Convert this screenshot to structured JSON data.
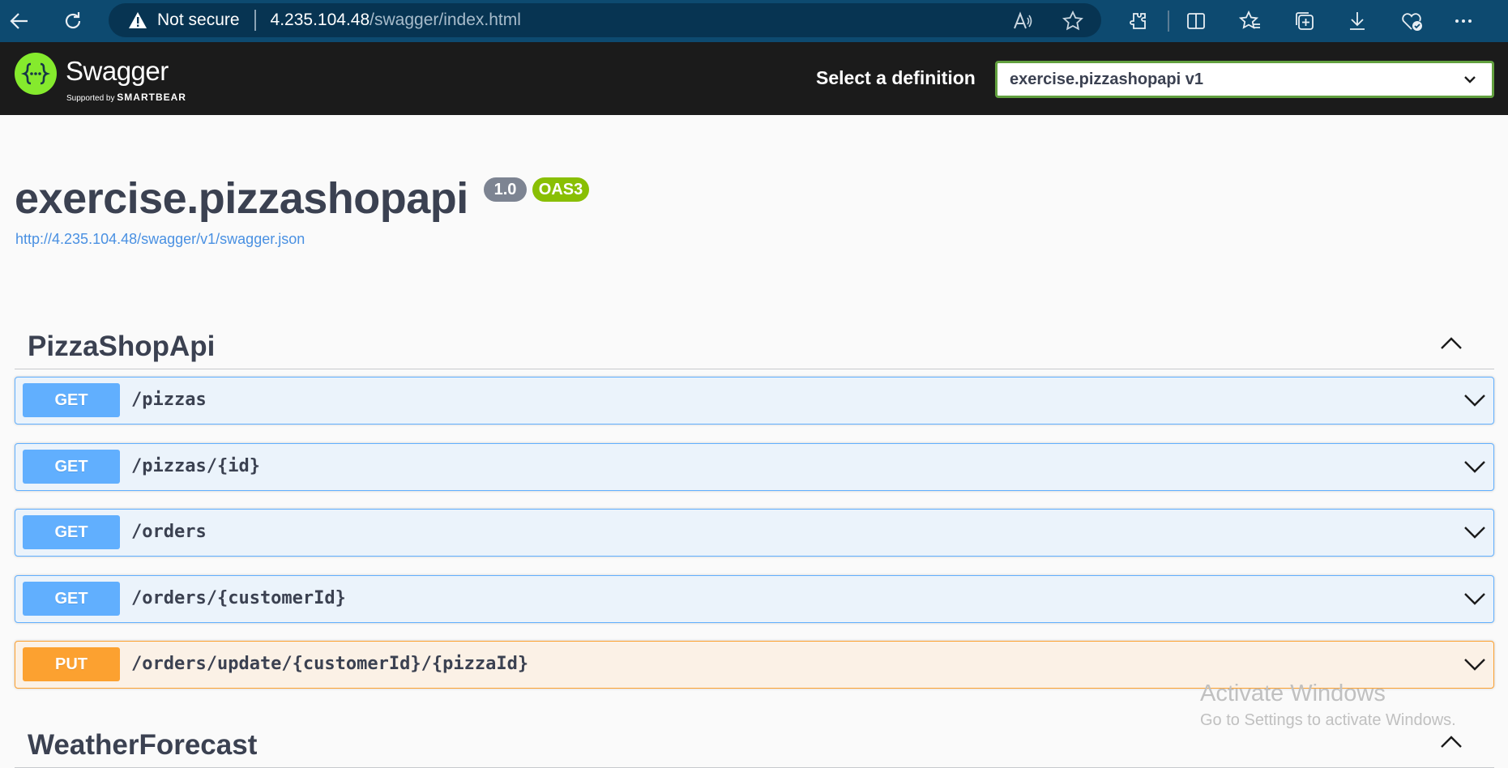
{
  "browser": {
    "not_secure": "Not secure",
    "url_host": "4.235.104.48",
    "url_path": "/swagger/index.html",
    "toolbar_icons": [
      "back-icon",
      "refresh-icon",
      "read-aloud-icon",
      "favorite-star-icon",
      "extensions-icon",
      "split-screen-icon",
      "favorites-icon",
      "collections-icon",
      "downloads-icon",
      "browser-essentials-icon",
      "more-icon"
    ]
  },
  "topbar": {
    "logo_text": "Swagger",
    "logo_sub_prefix": "Supported by",
    "logo_sub_brand": "SMARTBEAR",
    "definition_label": "Select a definition",
    "definition_selected": "exercise.pizzashopapi v1"
  },
  "info": {
    "title": "exercise.pizzashopapi",
    "version": "1.0",
    "oas": "OAS3",
    "spec_url": "http://4.235.104.48/swagger/v1/swagger.json"
  },
  "tags": [
    {
      "name": "PizzaShopApi",
      "operations": [
        {
          "method": "GET",
          "path": "/pizzas"
        },
        {
          "method": "GET",
          "path": "/pizzas/{id}"
        },
        {
          "method": "GET",
          "path": "/orders"
        },
        {
          "method": "GET",
          "path": "/orders/{customerId}"
        },
        {
          "method": "PUT",
          "path": "/orders/update/{customerId}/{pizzaId}"
        }
      ]
    },
    {
      "name": "WeatherForecast",
      "operations": []
    }
  ],
  "watermark": {
    "title": "Activate Windows",
    "subtitle": "Go to Settings to activate Windows."
  },
  "colors": {
    "get": "#61affe",
    "put": "#fca130",
    "swagger_green": "#85ea2d",
    "topbar": "#1b1b1b",
    "browser": "#0d4a70"
  }
}
